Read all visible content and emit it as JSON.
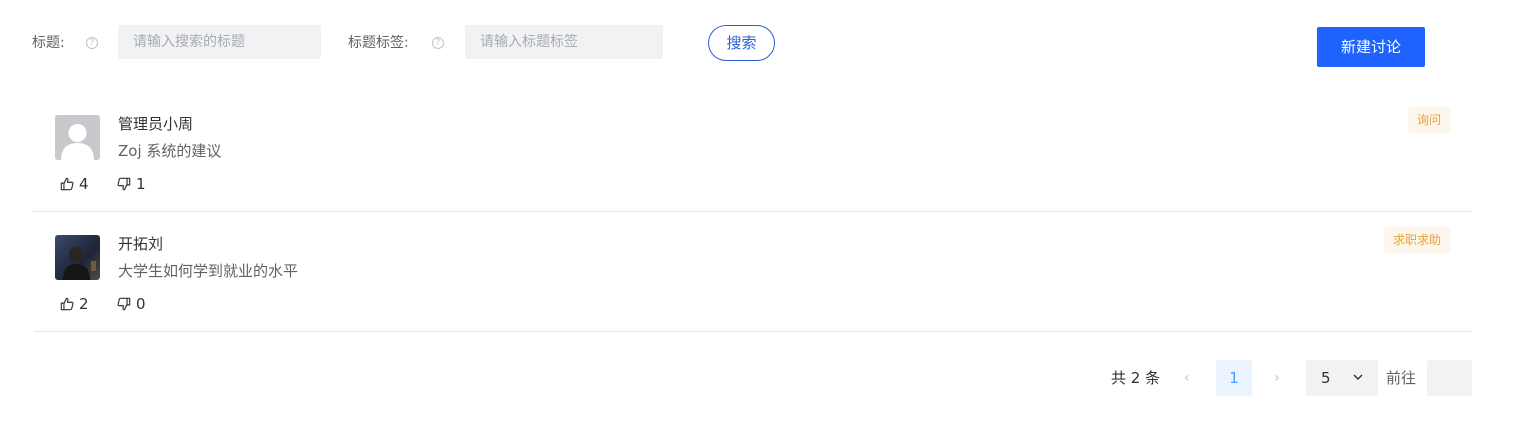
{
  "search": {
    "title_label": "标题:",
    "title_placeholder": "请输入搜索的标题",
    "tag_label": "标题标签:",
    "tag_placeholder": "请输入标题标签",
    "search_button": "搜索",
    "new_button": "新建讨论"
  },
  "posts": [
    {
      "author": "管理员小周",
      "title": "Zoj 系统的建议",
      "likes": "4",
      "dislikes": "1",
      "tag": "询问"
    },
    {
      "author": "开拓刘",
      "title": "大学生如何学到就业的水平",
      "likes": "2",
      "dislikes": "0",
      "tag": "求职求助"
    }
  ],
  "pagination": {
    "total": "共 2 条",
    "prev": "‹",
    "current_page": "1",
    "next": "›",
    "page_size": "5",
    "goto_label": "前往"
  },
  "colors": {
    "primary": "#1f63ff",
    "search_border": "#2b5fd9",
    "tag_text": "#e6a23c",
    "tag_bg": "#fdf6ec"
  }
}
